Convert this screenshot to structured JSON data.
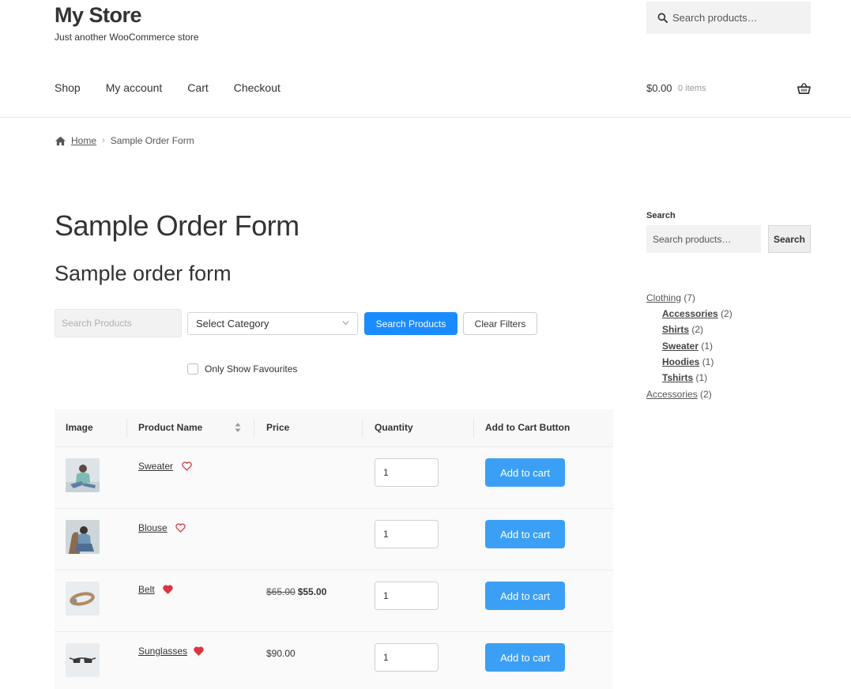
{
  "header": {
    "site_title": "My Store",
    "tagline": "Just another WooCommerce store",
    "search_placeholder": "Search products…"
  },
  "nav": {
    "items": [
      "Shop",
      "My account",
      "Cart",
      "Checkout"
    ]
  },
  "cart": {
    "total": "$0.00",
    "items": "0 items"
  },
  "breadcrumb": {
    "home": "Home",
    "current": "Sample Order Form"
  },
  "page": {
    "title": "Sample Order Form",
    "form_title": "Sample order form"
  },
  "filters": {
    "search_placeholder": "Search Products",
    "category_selected": "Select Category",
    "search_button": "Search Products",
    "clear_button": "Clear Filters",
    "favourites_label": "Only Show Favourites"
  },
  "table": {
    "headers": [
      "Image",
      "Product Name",
      "Price",
      "Quantity",
      "Add to Cart Button"
    ],
    "rows": [
      {
        "name": "Sweater",
        "favourite": false,
        "price_old": "",
        "price": "",
        "qty": "1",
        "button": "Add to cart"
      },
      {
        "name": "Blouse",
        "favourite": false,
        "price_old": "",
        "price": "",
        "qty": "1",
        "button": "Add to cart"
      },
      {
        "name": "Belt",
        "favourite": true,
        "price_old": "$65.00",
        "price": "$55.00",
        "qty": "1",
        "button": "Add to cart"
      },
      {
        "name": "Sunglasses",
        "favourite": true,
        "price_old": "",
        "price": "$90.00",
        "qty": "1",
        "button": "Add to cart"
      }
    ]
  },
  "sidebar": {
    "search_heading": "Search",
    "search_placeholder": "Search products…",
    "search_button": "Search",
    "categories": [
      {
        "name": "Clothing",
        "count": "(7)",
        "sub": false
      },
      {
        "name": "Accessories",
        "count": "(2)",
        "sub": true
      },
      {
        "name": "Shirts",
        "count": "(2)",
        "sub": true
      },
      {
        "name": "Sweater",
        "count": "(1)",
        "sub": true
      },
      {
        "name": "Hoodies",
        "count": "(1)",
        "sub": true
      },
      {
        "name": "Tshirts",
        "count": "(1)",
        "sub": true
      },
      {
        "name": "Accessories",
        "count": "(2)",
        "sub": false
      }
    ]
  },
  "colors": {
    "primary_button": "#1a8cff",
    "add_to_cart": "#3ba0f5",
    "heart": "#d9363e"
  }
}
